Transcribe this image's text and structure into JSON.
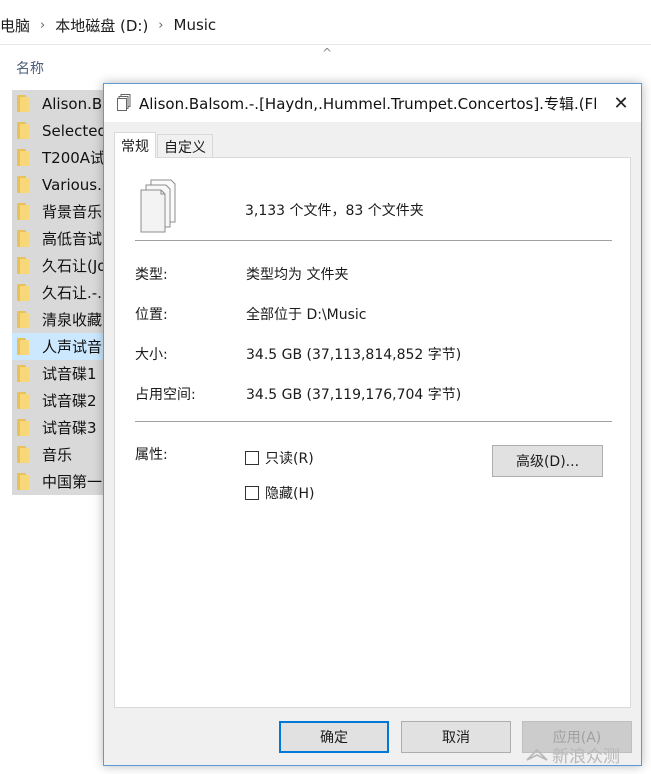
{
  "explorer": {
    "breadcrumb": [
      "电脑",
      "本地磁盘 (D:)",
      "Music"
    ],
    "column_header": "名称",
    "sort_indicator": "^",
    "files": [
      "Alison.Ba",
      "Selected",
      "T200A试",
      "Various..",
      "背景音乐",
      "高低音试",
      "久石让(Jo",
      "久石让.-.",
      "清泉收藏",
      "人声试音",
      "试音碟1",
      "试音碟2",
      "试音碟3",
      "音乐",
      "中国第一"
    ],
    "selected_index": 9
  },
  "dialog": {
    "title": "Alison.Balsom.-.[Haydn,.Hummel.Trumpet.Concertos].专辑.(Fl...",
    "close": "✕",
    "tabs": [
      "常规",
      "自定义"
    ],
    "active_tab": 0,
    "summary": "3,133 个文件，83 个文件夹",
    "type_label": "类型:",
    "type_value": "类型均为 文件夹",
    "location_label": "位置:",
    "location_value": "全部位于 D:\\Music",
    "size_label": "大小:",
    "size_value": "34.5 GB (37,113,814,852 字节)",
    "disk_size_label": "占用空间:",
    "disk_size_value": "34.5 GB (37,119,176,704 字节)",
    "attributes_label": "属性:",
    "readonly_label": "只读(R)",
    "hidden_label": "隐藏(H)",
    "advanced_button": "高级(D)...",
    "ok_button": "确定",
    "cancel_button": "取消",
    "apply_button": "应用(A)"
  },
  "watermark": "新浪众测"
}
